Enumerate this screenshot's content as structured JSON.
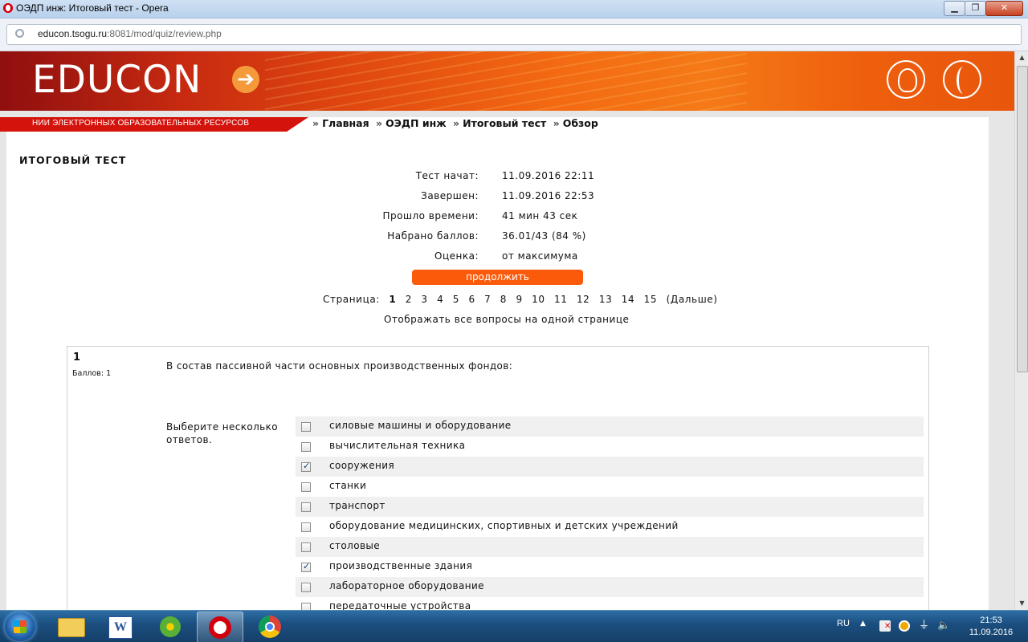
{
  "window": {
    "title": "ОЭДП инж: Итоговый тест - Opera",
    "minimize": "▁",
    "maximize": "❐",
    "close": "✕"
  },
  "address_bar": {
    "url_host": "educon.tsogu.ru",
    "url_rest": ":8081/mod/quiz/review.php"
  },
  "banner": {
    "logo": "EDUCON",
    "logo_arrow": "➔",
    "ribbon": "НИИ ЭЛЕКТРОННЫХ ОБРАЗОВАТЕЛЬНЫХ РЕСУРСОВ"
  },
  "breadcrumb": {
    "prefix": "»",
    "items": [
      "Главная",
      "ОЭДП инж",
      "Итоговый тест",
      "Обзор"
    ],
    "sep": "»"
  },
  "quiz": {
    "title": "ИТОГОВЫЙ ТЕСТ",
    "summary": [
      {
        "label": "Тест начат:",
        "value": "11.09.2016 22:11"
      },
      {
        "label": "Завершен:",
        "value": "11.09.2016 22:53"
      },
      {
        "label": "Прошло времени:",
        "value": "41 мин 43 сек"
      },
      {
        "label": "Набрано баллов:",
        "value": "36.01/43 (84 %)"
      },
      {
        "label": "Оценка:",
        "value": "от максимума"
      }
    ],
    "continue_label": "продолжить",
    "pager": {
      "label": "Страница:",
      "current": "1",
      "pages": [
        "2",
        "3",
        "4",
        "5",
        "6",
        "7",
        "8",
        "9",
        "10",
        "11",
        "12",
        "13",
        "14",
        "15"
      ],
      "next": "(Дальше)"
    },
    "show_all": "Отображать все вопросы на одной странице"
  },
  "question": {
    "number": "1",
    "score": "Баллов: 1",
    "text": "В состав пассивной части основных производственных фондов:",
    "prompt": "Выберите несколько ответов.",
    "answers": [
      {
        "text": "силовые машины и оборудование",
        "checked": false
      },
      {
        "text": "вычислительная техника",
        "checked": false
      },
      {
        "text": "сооружения",
        "checked": true
      },
      {
        "text": "станки",
        "checked": false
      },
      {
        "text": "транспорт",
        "checked": false
      },
      {
        "text": "оборудование медицинских, спортивных и детских учреждений",
        "checked": false
      },
      {
        "text": "столовые",
        "checked": false
      },
      {
        "text": "производственные здания",
        "checked": true
      },
      {
        "text": "лабораторное оборудование",
        "checked": false
      },
      {
        "text": "передаточные устройства",
        "checked": false
      }
    ]
  },
  "taskbar": {
    "apps": [
      "explorer-icon",
      "word-icon",
      "icq-icon",
      "opera-icon",
      "chrome-icon"
    ],
    "word_glyph": "W",
    "lang": "RU",
    "expand": "▲",
    "plug_glyph": "⏚",
    "volume_glyph": "🔈",
    "time": "21:53",
    "date": "11.09.2016"
  },
  "scrollbar": {
    "up": "▲",
    "down": "▼"
  }
}
